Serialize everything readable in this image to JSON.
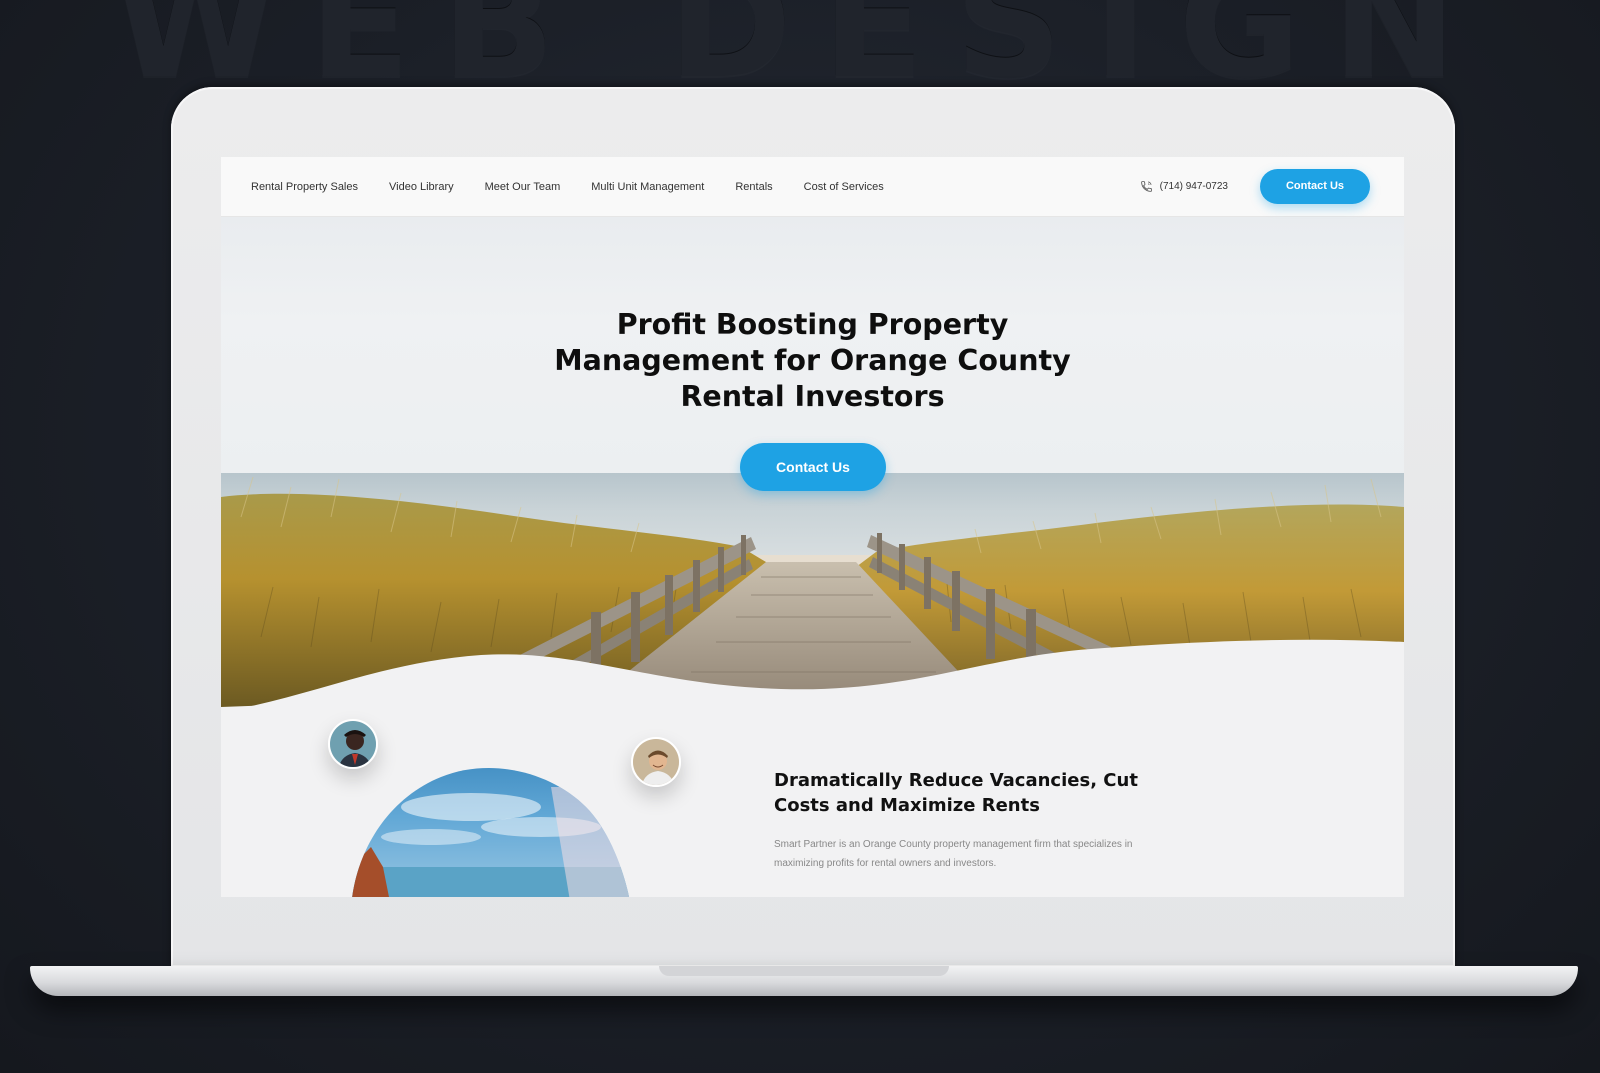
{
  "background_title": "WEB DESIGN",
  "nav": {
    "links": [
      "Rental Property Sales",
      "Video Library",
      "Meet Our Team",
      "Multi Unit Management",
      "Rentals",
      "Cost of Services"
    ],
    "phone": "(714) 947-0723",
    "contact_label": "Contact Us"
  },
  "hero": {
    "title_lines": [
      "Profit Boosting Property",
      "Management for Orange County",
      "Rental Investors"
    ],
    "cta_label": "Contact Us"
  },
  "section": {
    "title_lines": [
      "Dramatically Reduce Vacancies, Cut",
      "Costs and Maximize Rents"
    ],
    "text_lines": [
      "Smart Partner is an Orange County property management firm that specializes in",
      "maximizing profits for rental owners and investors."
    ]
  },
  "colors": {
    "accent": "#1ea2e4",
    "page_bg": "#1b1f27",
    "screen_bg": "#f2f2f3"
  },
  "icons": [
    "phone-icon"
  ]
}
